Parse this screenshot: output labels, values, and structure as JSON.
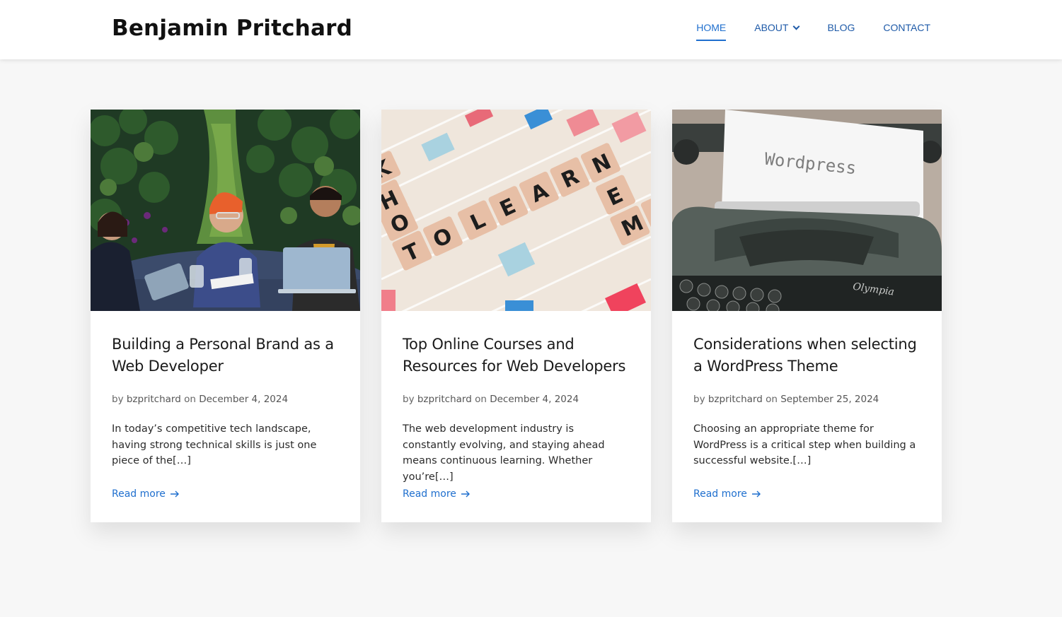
{
  "header": {
    "site_title": "Benjamin Pritchard",
    "nav": [
      {
        "label": "HOME",
        "active": true
      },
      {
        "label": "ABOUT",
        "has_dropdown": true
      },
      {
        "label": "BLOG"
      },
      {
        "label": "CONTACT"
      }
    ]
  },
  "posts": [
    {
      "title": "Building a Personal Brand as a Web Developer",
      "by": "by",
      "author": "bzpritchard",
      "on": "on",
      "date": "December 4, 2024",
      "excerpt": "In today’s competitive tech landscape, having strong technical skills is just one piece of the[…]",
      "read_more": "Read more",
      "image": "team-meeting-laptop-photo"
    },
    {
      "title": "Top Online Courses and Resources for Web Developers",
      "by": "by",
      "author": "bzpritchard",
      "on": "on",
      "date": "December 4, 2024",
      "excerpt": "The web development industry is constantly evolving, and staying ahead means continuous learning. Whether you’re[…]",
      "read_more": "Read more",
      "image": "scrabble-learn-tiles-photo"
    },
    {
      "title": "Considerations when selecting a WordPress Theme",
      "by": "by",
      "author": "bzpritchard",
      "on": "on",
      "date": "September 25, 2024",
      "excerpt": "Choosing an appropriate theme for WordPress is a critical step when building a successful website.[…]",
      "read_more": "Read more",
      "image": "typewriter-wordpress-photo",
      "image_text": "Wordpress"
    }
  ],
  "colors": {
    "accent": "#1f6fce",
    "nav": "#1e5aa8",
    "background": "#f7f7f7"
  }
}
